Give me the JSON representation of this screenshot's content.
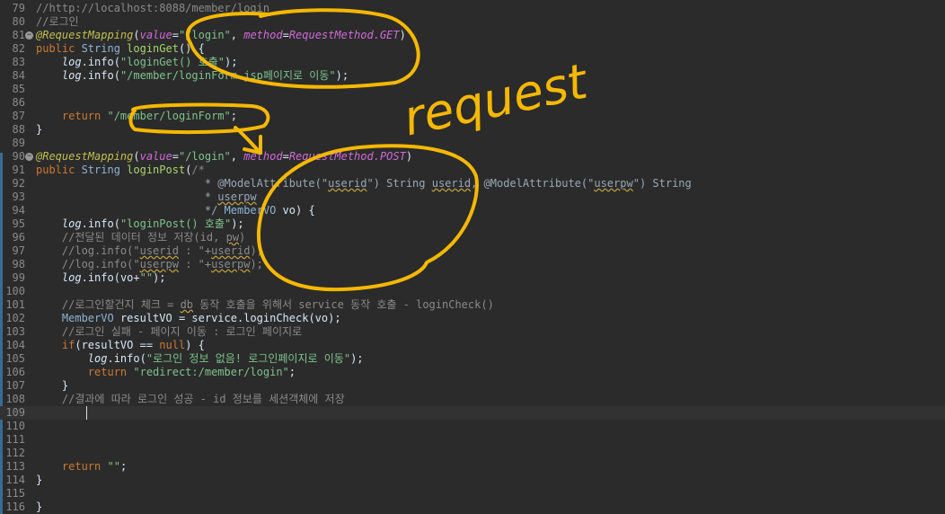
{
  "editor": {
    "lines": [
      {
        "n": "79",
        "tokens": [
          [
            "cm",
            "//http://localhost:8088/member/login"
          ]
        ]
      },
      {
        "n": "80",
        "tokens": [
          [
            "cm",
            "//로그인"
          ]
        ]
      },
      {
        "n": "81",
        "fold": true,
        "tokens": [
          [
            "an",
            "@RequestMapping"
          ],
          [
            "pl",
            "("
          ],
          [
            "ev",
            "value"
          ],
          [
            "pl",
            "="
          ],
          [
            "st",
            "\"/login\""
          ],
          [
            "pl",
            ", "
          ],
          [
            "ev",
            "method"
          ],
          [
            "pl",
            "="
          ],
          [
            "ev",
            "RequestMethod.GET"
          ],
          [
            "pl",
            ")"
          ]
        ]
      },
      {
        "n": "82",
        "tokens": [
          [
            "kw",
            "public "
          ],
          [
            "ty",
            "String "
          ],
          [
            "md",
            "loginGet"
          ],
          [
            "pl",
            "() {"
          ]
        ]
      },
      {
        "n": "83",
        "tokens": [
          [
            "pl",
            "    "
          ],
          [
            "lg",
            "log"
          ],
          [
            "pl",
            ".info("
          ],
          [
            "st",
            "\"loginGet() 호출\""
          ],
          [
            "pl",
            ");"
          ]
        ]
      },
      {
        "n": "84",
        "tokens": [
          [
            "pl",
            "    "
          ],
          [
            "lg",
            "log"
          ],
          [
            "pl",
            ".info("
          ],
          [
            "st",
            "\"/member/loginForm.jsp페이지로 이동\""
          ],
          [
            "pl",
            ");"
          ]
        ]
      },
      {
        "n": "85",
        "tokens": []
      },
      {
        "n": "86",
        "tokens": []
      },
      {
        "n": "87",
        "tokens": [
          [
            "pl",
            "    "
          ],
          [
            "kw",
            "return "
          ],
          [
            "st",
            "\"/member/loginForm\""
          ],
          [
            "pl",
            ";"
          ]
        ]
      },
      {
        "n": "88",
        "tokens": [
          [
            "pl",
            "}"
          ]
        ]
      },
      {
        "n": "89",
        "tokens": []
      },
      {
        "n": "90",
        "fold": true,
        "tokens": [
          [
            "an",
            "@RequestMapping"
          ],
          [
            "pl",
            "("
          ],
          [
            "ev",
            "value"
          ],
          [
            "pl",
            "="
          ],
          [
            "st",
            "\"/login\""
          ],
          [
            "pl",
            ", "
          ],
          [
            "ev",
            "method"
          ],
          [
            "pl",
            "="
          ],
          [
            "ev",
            "RequestMethod.POST"
          ],
          [
            "pl",
            ")"
          ]
        ]
      },
      {
        "n": "91",
        "tokens": [
          [
            "kw",
            "public "
          ],
          [
            "ty",
            "String "
          ],
          [
            "md",
            "loginPost"
          ],
          [
            "pl",
            "("
          ],
          [
            "cm",
            "/*"
          ]
        ]
      },
      {
        "n": "92",
        "tokens": [
          [
            "jd",
            "                          * @ModelAttribute(\""
          ],
          [
            "jdsq",
            "userid"
          ],
          [
            "jd",
            "\") String "
          ],
          [
            "jdsq",
            "userid"
          ],
          [
            "jd",
            ", @ModelAttribute(\""
          ],
          [
            "jdsq",
            "userpw"
          ],
          [
            "jd",
            "\") String"
          ]
        ]
      },
      {
        "n": "93",
        "tokens": [
          [
            "jd",
            "                          * "
          ],
          [
            "jdsq",
            "userpw"
          ]
        ]
      },
      {
        "n": "94",
        "tokens": [
          [
            "jd",
            "                          */ "
          ],
          [
            "ty",
            "MemberVO "
          ],
          [
            "pl",
            "vo) {"
          ]
        ]
      },
      {
        "n": "95",
        "tokens": [
          [
            "pl",
            "    "
          ],
          [
            "lg",
            "log"
          ],
          [
            "pl",
            ".info("
          ],
          [
            "st",
            "\"loginPost() 호출\""
          ],
          [
            "pl",
            ");"
          ]
        ]
      },
      {
        "n": "96",
        "tokens": [
          [
            "pl",
            "    "
          ],
          [
            "cm",
            "//전달된 데이터 정보 저장(id, "
          ],
          [
            "cmsq",
            "pw"
          ],
          [
            "cm",
            ")"
          ]
        ]
      },
      {
        "n": "97",
        "tokens": [
          [
            "pl",
            "    "
          ],
          [
            "cm",
            "//log.info(\""
          ],
          [
            "cmsq",
            "userid"
          ],
          [
            "cm",
            " : \"+"
          ],
          [
            "cmsq",
            "userid"
          ],
          [
            "cm",
            ");"
          ]
        ]
      },
      {
        "n": "98",
        "tokens": [
          [
            "pl",
            "    "
          ],
          [
            "cm",
            "//log.info(\""
          ],
          [
            "cmsq",
            "userpw"
          ],
          [
            "cm",
            " : \"+"
          ],
          [
            "cmsq",
            "userpw"
          ],
          [
            "cm",
            ");"
          ]
        ]
      },
      {
        "n": "99",
        "tokens": [
          [
            "pl",
            "    "
          ],
          [
            "lg",
            "log"
          ],
          [
            "pl",
            ".info(vo+"
          ],
          [
            "st",
            "\"\""
          ],
          [
            "pl",
            ");"
          ]
        ]
      },
      {
        "n": "100",
        "tokens": []
      },
      {
        "n": "101",
        "tokens": [
          [
            "pl",
            "    "
          ],
          [
            "cm",
            "//로그인할건지 체크 = "
          ],
          [
            "cmsq",
            "db"
          ],
          [
            "cm",
            " 동작 호출을 위해서 service 동작 호출 - loginCheck()"
          ]
        ]
      },
      {
        "n": "102",
        "tokens": [
          [
            "pl",
            "    "
          ],
          [
            "ty",
            "MemberVO "
          ],
          [
            "pl",
            "resultVO = service.loginCheck(vo);"
          ]
        ]
      },
      {
        "n": "103",
        "tokens": [
          [
            "pl",
            "    "
          ],
          [
            "cm",
            "//로그인 실패 - 페이지 이동 : 로그인 페이지로"
          ]
        ]
      },
      {
        "n": "104",
        "tokens": [
          [
            "pl",
            "    "
          ],
          [
            "kw",
            "if"
          ],
          [
            "pl",
            "(resultVO == "
          ],
          [
            "kw",
            "null"
          ],
          [
            "pl",
            ") {"
          ]
        ]
      },
      {
        "n": "105",
        "tokens": [
          [
            "pl",
            "        "
          ],
          [
            "lg",
            "log"
          ],
          [
            "pl",
            ".info("
          ],
          [
            "st",
            "\"로그인 정보 없음! 로그인페이지로 이동\""
          ],
          [
            "pl",
            ");"
          ]
        ]
      },
      {
        "n": "106",
        "tokens": [
          [
            "pl",
            "        "
          ],
          [
            "kw",
            "return "
          ],
          [
            "st",
            "\"redirect:/member/login\""
          ],
          [
            "pl",
            ";"
          ]
        ]
      },
      {
        "n": "107",
        "tokens": [
          [
            "pl",
            "    }"
          ]
        ]
      },
      {
        "n": "108",
        "tokens": [
          [
            "pl",
            "    "
          ],
          [
            "cm",
            "//결과에 따라 로그인 성공 - id 정보를 세션객체에 저장"
          ]
        ]
      },
      {
        "n": "109",
        "current": true,
        "tokens": []
      },
      {
        "n": "110",
        "tokens": []
      },
      {
        "n": "111",
        "tokens": []
      },
      {
        "n": "112",
        "tokens": []
      },
      {
        "n": "113",
        "tokens": [
          [
            "pl",
            "    "
          ],
          [
            "kw",
            "return "
          ],
          [
            "st",
            "\"\""
          ],
          [
            "pl",
            ";"
          ]
        ]
      },
      {
        "n": "114",
        "tokens": [
          [
            "pl",
            "}"
          ]
        ]
      },
      {
        "n": "115",
        "tokens": []
      },
      {
        "n": "116",
        "tokens": [
          [
            "pl",
            "}"
          ]
        ]
      }
    ]
  },
  "annotation": {
    "text": "request",
    "color": "#f5b800"
  },
  "colors": {
    "background": "#2b2b2b",
    "keyword": "#cc7832",
    "string": "#7ec38c",
    "comment": "#8a8a8a",
    "annotation": "#bfbf50",
    "enum": "#d26ad8",
    "ink": "#f5b800"
  }
}
